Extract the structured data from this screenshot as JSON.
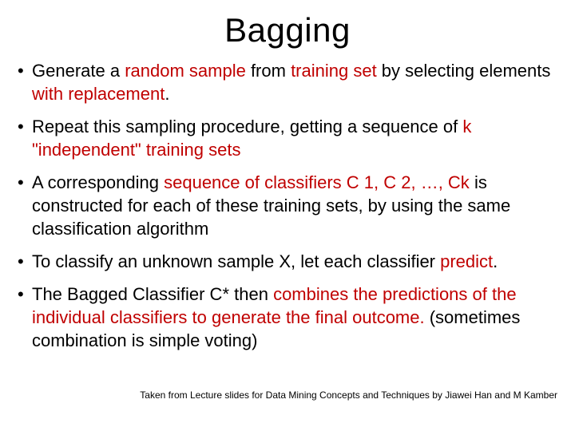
{
  "title": "Bagging",
  "bullets": [
    {
      "pre": "Generate a ",
      "hl1": "random sample ",
      "mid": "from ",
      "hl2": "training set ",
      "mid2": "by selecting elements ",
      "hl3": "with replacement",
      "post": "."
    },
    {
      "pre": "Repeat this sampling procedure, getting a sequence of ",
      "hl1": "k \"independent\" training sets",
      "post": ""
    },
    {
      "pre": "A corresponding ",
      "hl1": "sequence of classifiers C 1, C 2, …, Ck ",
      "post": "is constructed for each of these training sets, by using the same classification algorithm"
    },
    {
      "pre": "To classify an unknown sample X, let each classifier ",
      "hl1": "predict",
      "post": "."
    },
    {
      "pre": "The Bagged Classifier C* then ",
      "hl1": "combines the predictions of the individual classifiers to generate the final outcome. ",
      "post": "(sometimes combination is simple voting)"
    }
  ],
  "attribution": "Taken from Lecture slides for Data Mining Concepts and Techniques by Jiawei Han and M Kamber"
}
